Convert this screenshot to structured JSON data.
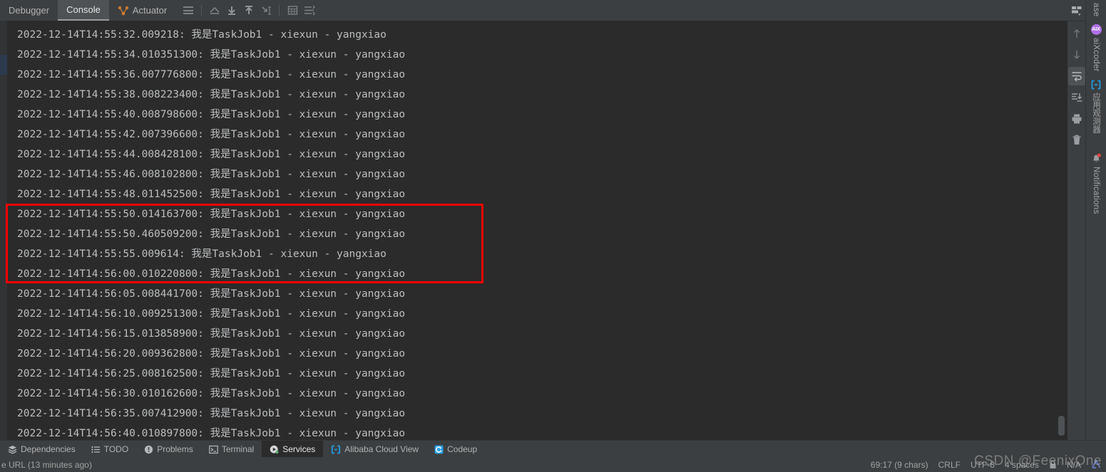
{
  "top_tabs": [
    {
      "label": "Debugger",
      "icon": null,
      "active": false
    },
    {
      "label": "Console",
      "icon": null,
      "active": true
    },
    {
      "label": "Actuator",
      "icon": "actuator-icon",
      "active": false
    }
  ],
  "top_toolbar": [
    {
      "name": "soft-wrap-icon",
      "title": "Soft-Wrap"
    },
    {
      "name": "scroll-to-top-icon",
      "title": "Scroll to Top"
    },
    {
      "name": "scroll-down-icon",
      "title": "Scroll Down"
    },
    {
      "name": "scroll-up-icon",
      "title": "Scroll Up"
    },
    {
      "name": "scroll-to-end-icon",
      "title": "Scroll to End"
    },
    {
      "name": "table-view-icon",
      "title": "Table View"
    },
    {
      "name": "format-icon",
      "title": "Format"
    }
  ],
  "console": {
    "lines": [
      "2022-12-14T14:55:32.009218: 我是TaskJob1 - xiexun - yangxiao",
      "2022-12-14T14:55:34.010351300: 我是TaskJob1 - xiexun - yangxiao",
      "2022-12-14T14:55:36.007776800: 我是TaskJob1 - xiexun - yangxiao",
      "2022-12-14T14:55:38.008223400: 我是TaskJob1 - xiexun - yangxiao",
      "2022-12-14T14:55:40.008798600: 我是TaskJob1 - xiexun - yangxiao",
      "2022-12-14T14:55:42.007396600: 我是TaskJob1 - xiexun - yangxiao",
      "2022-12-14T14:55:44.008428100: 我是TaskJob1 - xiexun - yangxiao",
      "2022-12-14T14:55:46.008102800: 我是TaskJob1 - xiexun - yangxiao",
      "2022-12-14T14:55:48.011452500: 我是TaskJob1 - xiexun - yangxiao",
      "2022-12-14T14:55:50.014163700: 我是TaskJob1 - xiexun - yangxiao",
      "2022-12-14T14:55:50.460509200: 我是TaskJob1 - xiexun - yangxiao",
      "2022-12-14T14:55:55.009614: 我是TaskJob1 - xiexun - yangxiao",
      "2022-12-14T14:56:00.010220800: 我是TaskJob1 - xiexun - yangxiao",
      "2022-12-14T14:56:05.008441700: 我是TaskJob1 - xiexun - yangxiao",
      "2022-12-14T14:56:10.009251300: 我是TaskJob1 - xiexun - yangxiao",
      "2022-12-14T14:56:15.013858900: 我是TaskJob1 - xiexun - yangxiao",
      "2022-12-14T14:56:20.009362800: 我是TaskJob1 - xiexun - yangxiao",
      "2022-12-14T14:56:25.008162500: 我是TaskJob1 - xiexun - yangxiao",
      "2022-12-14T14:56:30.010162600: 我是TaskJob1 - xiexun - yangxiao",
      "2022-12-14T14:56:35.007412900: 我是TaskJob1 - xiexun - yangxiao",
      "2022-12-14T14:56:40.010897800: 我是TaskJob1 - xiexun - yangxiao"
    ],
    "highlight_color": "#ff0000",
    "highlight_first_line_index": 8,
    "highlight_last_line_index": 11
  },
  "right_sidebar": {
    "layout_button": "layout-icon",
    "buttons": [
      {
        "name": "scroll-up-arrow-icon",
        "selected": false
      },
      {
        "name": "scroll-down-arrow-icon",
        "selected": false
      },
      {
        "name": "soft-wrap-toggle-icon",
        "selected": true
      },
      {
        "name": "scroll-to-end-icon",
        "selected": false
      },
      {
        "name": "print-icon",
        "selected": false
      },
      {
        "name": "trash-icon",
        "selected": false
      }
    ]
  },
  "far_right_tabs": [
    {
      "label": "ase",
      "icon": "database-icon",
      "full": "Database"
    },
    {
      "label": "aiXcoder",
      "icon": "aixcoder-icon",
      "badge": "AIX"
    },
    {
      "label": "应用观测器",
      "icon": "app-observer-icon"
    },
    {
      "label": "Notifications",
      "icon": "bell-icon",
      "has_dot": true
    }
  ],
  "bottom_tabs": [
    {
      "label": "Dependencies",
      "icon": "layers-icon",
      "active": false
    },
    {
      "label": "TODO",
      "icon": "todo-list-icon",
      "active": false
    },
    {
      "label": "Problems",
      "icon": "problems-icon",
      "active": false
    },
    {
      "label": "Terminal",
      "icon": "terminal-icon",
      "active": false
    },
    {
      "label": "Services",
      "icon": "services-play-icon",
      "active": true
    },
    {
      "label": "Alibaba Cloud View",
      "icon": "alibaba-cloud-icon",
      "active": false
    },
    {
      "label": "Codeup",
      "icon": "codeup-icon",
      "active": false
    }
  ],
  "status_bar": {
    "left_text": "e URL (13 minutes ago)",
    "caret": "69:17 (9 chars)",
    "line_separator": "CRLF",
    "encoding": "UTF-8",
    "indent": "4 spaces",
    "branch": "N/A"
  },
  "watermark": "CSDN @FeenixOne",
  "colors": {
    "console_bg": "#2b2b2b",
    "chrome_bg": "#3c3f41",
    "text": "#bcbec0",
    "accent_orange": "#cc7832",
    "highlight_red": "#ff0000",
    "aix_purple": "#b06fe8",
    "cloud_blue": "#1e9ae0",
    "active_tab_bg": "#4e5254"
  }
}
